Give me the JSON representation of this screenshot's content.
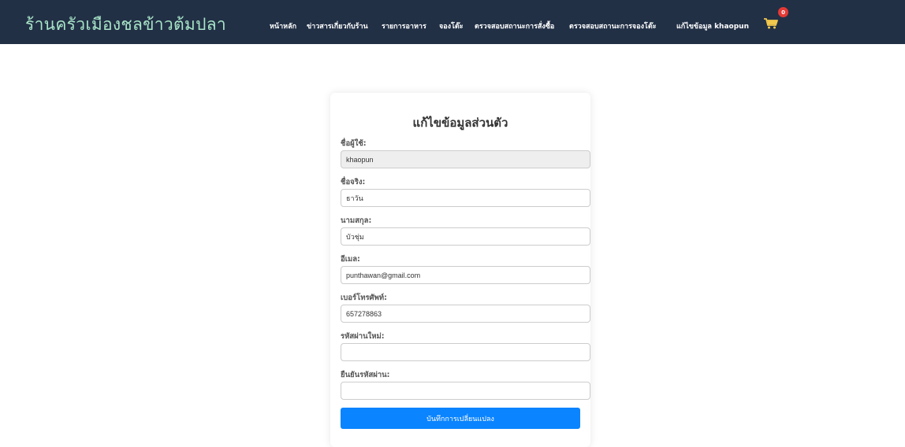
{
  "brand": "ร้านครัวเมืองชลข้าวต้มปลา",
  "nav": [
    {
      "label": "หน้าหลัก"
    },
    {
      "label": "ข่าวสารเกี่ยวกับร้าน"
    },
    {
      "label": "รายการอาหาร"
    },
    {
      "label": "จองโต๊ะ"
    },
    {
      "label": "ตรวจสอบสถานะการสั่งซื้อ"
    },
    {
      "label": "ตรวจสอบสถานะการจองโต๊ะ"
    },
    {
      "label": "แก้ไขข้อมูล khaopun"
    }
  ],
  "cart": {
    "count": "0",
    "icon": "cart-icon"
  },
  "form": {
    "title": "แก้ไขข้อมูลส่วนตัว",
    "username": {
      "label": "ชื่อผู้ใช้:",
      "value": "khaopun"
    },
    "firstname": {
      "label": "ชื่อจริง:",
      "value": "ธาวัน"
    },
    "lastname": {
      "label": "นามสกุล:",
      "value": "บัวชุ่ม"
    },
    "email": {
      "label": "อีเมล:",
      "value": "punthawan@gmail.com"
    },
    "phone": {
      "label": "เบอร์โทรศัพท์:",
      "value": "657278863"
    },
    "new_password": {
      "label": "รหัสผ่านใหม่:",
      "value": ""
    },
    "confirm_password": {
      "label": "ยืนยันรหัสผ่าน:",
      "value": ""
    },
    "submit_label": "บันทึกการเปลี่ยนแปลง"
  },
  "colors": {
    "navbar": "#223046",
    "brand": "#a9e6c8",
    "button": "#0a84ff",
    "badge": "#e53935"
  }
}
